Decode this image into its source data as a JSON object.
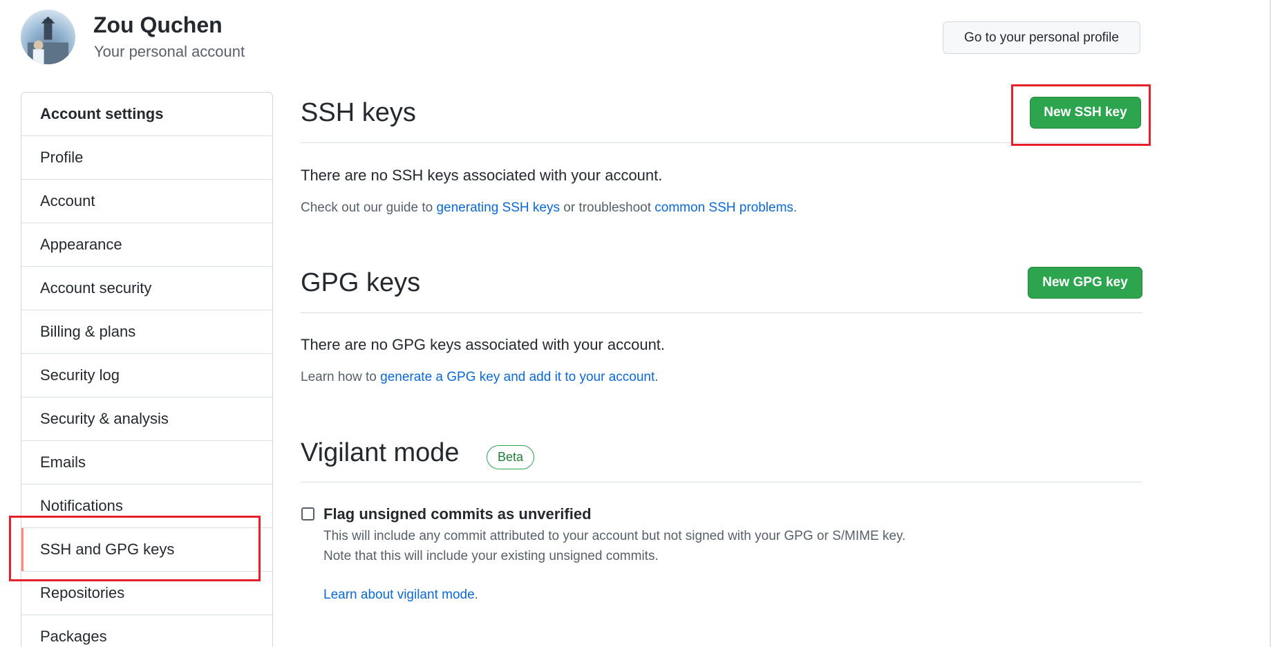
{
  "header": {
    "username": "Zou Quchen",
    "subtitle": "Your personal account",
    "profile_button": "Go to your personal profile"
  },
  "sidebar": {
    "heading": "Account settings",
    "items": [
      {
        "label": "Profile"
      },
      {
        "label": "Account"
      },
      {
        "label": "Appearance"
      },
      {
        "label": "Account security"
      },
      {
        "label": "Billing & plans"
      },
      {
        "label": "Security log"
      },
      {
        "label": "Security & analysis"
      },
      {
        "label": "Emails"
      },
      {
        "label": "Notifications"
      },
      {
        "label": "SSH and GPG keys",
        "selected": true
      },
      {
        "label": "Repositories"
      },
      {
        "label": "Packages"
      }
    ]
  },
  "ssh": {
    "title": "SSH keys",
    "button": "New SSH key",
    "empty": "There are no SSH keys associated with your account.",
    "guide_prefix": "Check out our guide to ",
    "guide_link": "generating SSH keys",
    "guide_middle": " or troubleshoot ",
    "problems_link": "common SSH problems",
    "guide_suffix": "."
  },
  "gpg": {
    "title": "GPG keys",
    "button": "New GPG key",
    "empty": "There are no GPG keys associated with your account.",
    "learn_prefix": "Learn how to ",
    "learn_link": "generate a GPG key and add it to your account",
    "learn_suffix": "."
  },
  "vigilant": {
    "title": "Vigilant mode",
    "badge": "Beta",
    "checkbox_label": "Flag unsigned commits as unverified",
    "checked": false,
    "desc_line1": "This will include any commit attributed to your account but not signed with your GPG or S/MIME key.",
    "desc_line2": "Note that this will include your existing unsigned commits.",
    "learn_link": "Learn about vigilant mode",
    "learn_suffix": "."
  },
  "colors": {
    "accent_green": "#2da44e",
    "link_blue": "#0969da",
    "highlight_red": "#e5202b",
    "selected_marker": "#fd8c73"
  }
}
